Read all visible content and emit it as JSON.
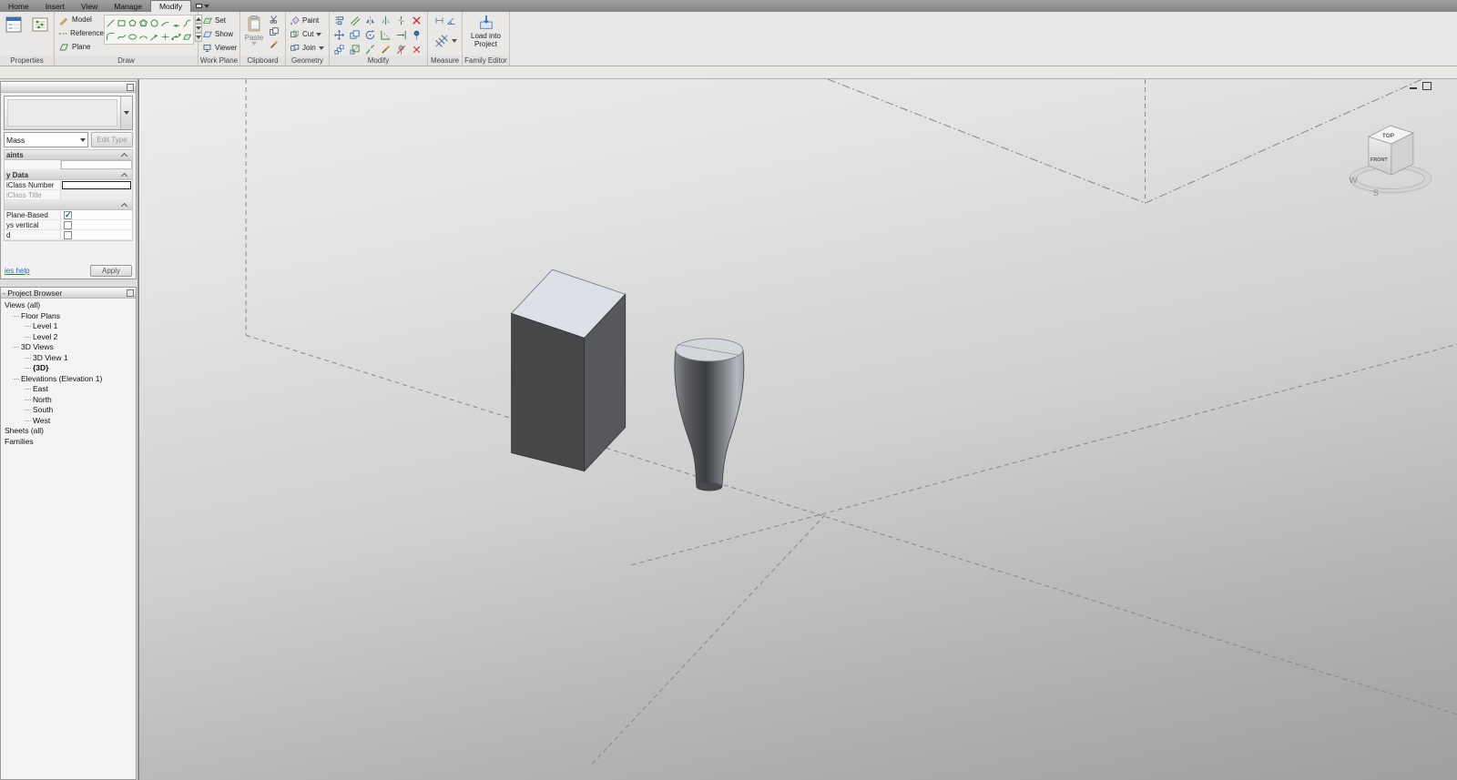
{
  "colors": {
    "ribbon_bg": "#e9e8e7",
    "tabbar_bg": "#8f8f8f",
    "canvas_top": "#ededed",
    "canvas_bottom": "#9f9f9f",
    "reference_plane": "#8e8094",
    "box_front": "#464749",
    "box_right": "#56585c",
    "box_top": "#dce1e8",
    "delete_red": "#c43a34",
    "accent_blue": "#2d6db5",
    "draw_green": "#3a8a3a",
    "help_link_blue": "#2a62c4"
  },
  "icons": {
    "chevron-down": "triangle-down",
    "section-collapse": "chevron-up",
    "check-mark": "✓",
    "delete": "red-x",
    "properties": "palette-window",
    "paste": "clipboard",
    "load-into-project": "box-with-arrow"
  },
  "tabbar": {
    "active": "Modify",
    "tabs": [
      {
        "label": "Home"
      },
      {
        "label": "Insert"
      },
      {
        "label": "View"
      },
      {
        "label": "Manage"
      },
      {
        "label": "Modify"
      }
    ]
  },
  "ribbon": {
    "properties_panel": {
      "label": "Properties"
    },
    "draw_panel": {
      "label": "Draw",
      "modes": [
        {
          "label": "Model"
        },
        {
          "label": "Reference"
        },
        {
          "label": "Plane"
        }
      ]
    },
    "workplane_panel": {
      "label": "Work Plane",
      "buttons": [
        {
          "label": "Set"
        },
        {
          "label": "Show"
        },
        {
          "label": "Viewer"
        }
      ]
    },
    "clipboard_panel": {
      "label": "Clipboard",
      "paste": "Paste"
    },
    "geometry_panel": {
      "label": "Geometry",
      "buttons": [
        {
          "label": "Paint"
        },
        {
          "label": "Cut"
        },
        {
          "label": "Join"
        }
      ]
    },
    "modify_panel": {
      "label": "Modify"
    },
    "measure_panel": {
      "label": "Measure"
    },
    "family_editor_panel": {
      "label": "Family Editor",
      "load_button": "Load into Project"
    }
  },
  "properties_palette": {
    "title": "",
    "type_value": "Mass",
    "edit_type_label": "Edit Type",
    "section_constraints_label": "aints",
    "section_identity_label": "y Data",
    "omniclass_number_label": "iClass Number",
    "omniclass_number_value": "",
    "omniclass_title_label": "iClass Title",
    "section_other_label": "",
    "workplane_based_label": "Plane-Based",
    "workplane_based_checked": true,
    "always_vertical_label": "ys vertical",
    "always_vertical_checked": false,
    "shared_label": "d",
    "shared_checked": false,
    "help_link_label": "ies help",
    "apply_label": "Apply"
  },
  "project_browser": {
    "title": "- Project Browser",
    "items": [
      {
        "label": "Views (all)",
        "indent": 0
      },
      {
        "label": "Floor Plans",
        "indent": 1
      },
      {
        "label": "Level 1",
        "indent": 2
      },
      {
        "label": "Level 2",
        "indent": 2
      },
      {
        "label": "3D Views",
        "indent": 1
      },
      {
        "label": "3D View 1",
        "indent": 2
      },
      {
        "label": "{3D}",
        "indent": 2,
        "selected": true
      },
      {
        "label": "Elevations (Elevation 1)",
        "indent": 1
      },
      {
        "label": "East",
        "indent": 2
      },
      {
        "label": "North",
        "indent": 2
      },
      {
        "label": "South",
        "indent": 2
      },
      {
        "label": "West",
        "indent": 2
      },
      {
        "label": "Sheets (all)",
        "indent": 0
      },
      {
        "label": "Families",
        "indent": 0
      }
    ]
  },
  "canvas": {
    "viewcube": {
      "top": "TOP",
      "front": "FRONT",
      "west": "W",
      "south": "S"
    },
    "scene_objects": [
      "box-extrusion-mass",
      "vase-revolve-mass"
    ]
  }
}
